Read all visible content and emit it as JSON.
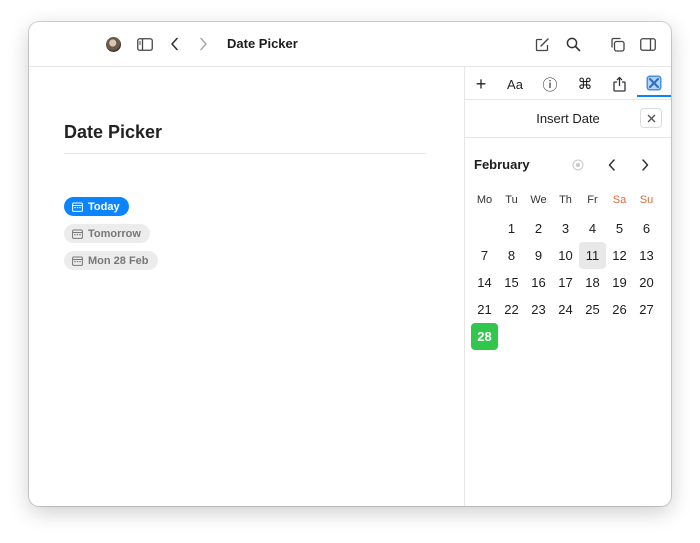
{
  "toolbar": {
    "title": "Date Picker",
    "icons": [
      "avatar",
      "sidebar-toggle-icon",
      "back-icon",
      "forward-icon",
      "compose-icon",
      "search-icon",
      "windows-icon",
      "right-sidebar-icon"
    ]
  },
  "document": {
    "title": "Date Picker",
    "chips": [
      {
        "label": "Today",
        "style": "primary"
      },
      {
        "label": "Tomorrow",
        "style": "secondary"
      },
      {
        "label": "Mon 28 Feb",
        "style": "secondary"
      }
    ]
  },
  "sidebar": {
    "tabs": [
      {
        "icon": "plus-icon",
        "label": "+"
      },
      {
        "icon": "text-format-icon",
        "label": "Aa"
      },
      {
        "icon": "info-icon",
        "label": "ⓘ"
      },
      {
        "icon": "command-icon",
        "label": "⌘"
      },
      {
        "icon": "share-icon",
        "label": ""
      },
      {
        "icon": "plugin-icon",
        "label": ""
      }
    ],
    "active_tab": 5,
    "panel_title": "Insert Date",
    "calendar": {
      "month": "February",
      "weekdays": [
        "Mo",
        "Tu",
        "We",
        "Th",
        "Fr",
        "Sa",
        "Su"
      ],
      "weekend_color": "#e2683a",
      "weeks": [
        [
          "",
          "1",
          "2",
          "3",
          "4",
          "5",
          "6"
        ],
        [
          "7",
          "8",
          "9",
          "10",
          "11",
          "12",
          "13"
        ],
        [
          "14",
          "15",
          "16",
          "17",
          "18",
          "19",
          "20"
        ],
        [
          "21",
          "22",
          "23",
          "24",
          "25",
          "26",
          "27"
        ],
        [
          "28",
          "",
          "",
          "",
          "",
          "",
          ""
        ]
      ],
      "highlighted_day": "11",
      "selected_day": "28",
      "selected_color": "#30c74c"
    }
  },
  "colors": {
    "accent": "#0a84ff",
    "chip_secondary_bg": "#ececec"
  }
}
